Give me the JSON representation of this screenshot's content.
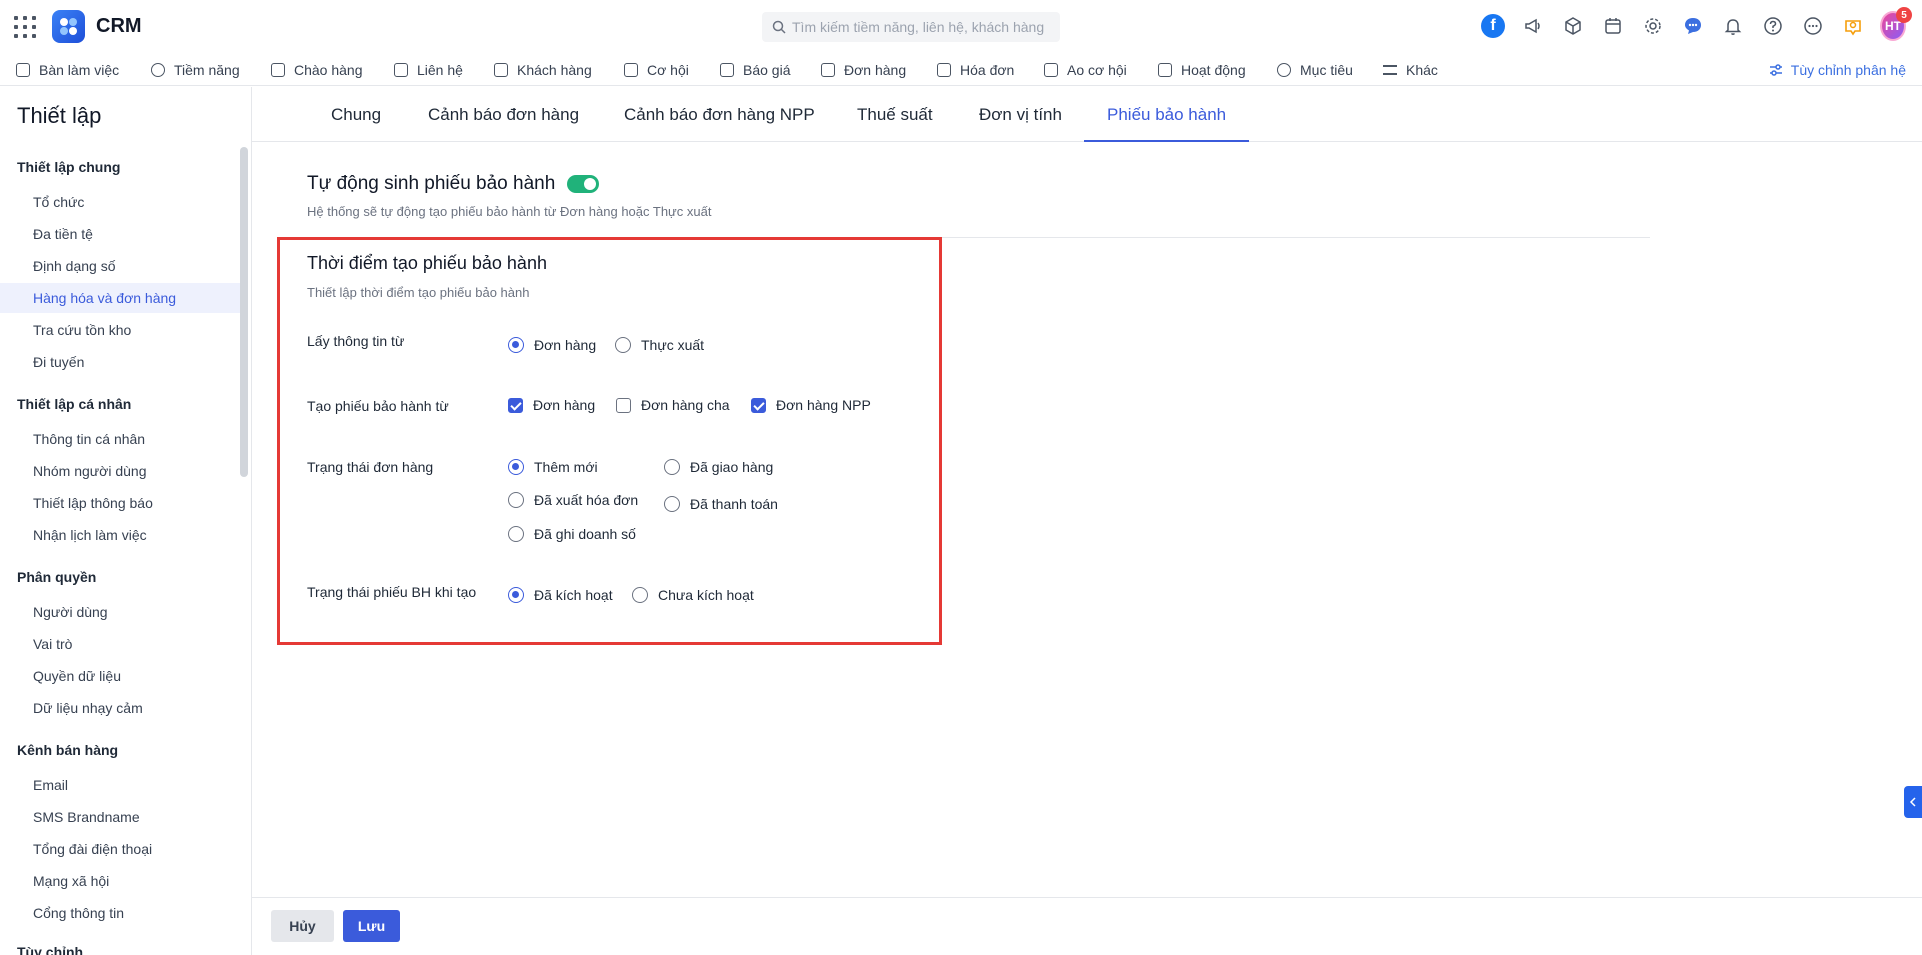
{
  "app": {
    "title": "CRM"
  },
  "search": {
    "placeholder": "Tìm kiếm tiềm năng, liên hệ, khách hàng"
  },
  "header": {
    "notification_count": "5",
    "avatar_initials": "HT"
  },
  "nav": {
    "items": [
      {
        "label": "Bàn làm việc",
        "icon": "home-icon"
      },
      {
        "label": "Tiềm năng",
        "icon": "user-circle-icon"
      },
      {
        "label": "Chào hàng",
        "icon": "magnet-icon"
      },
      {
        "label": "Liên hệ",
        "icon": "contact-icon"
      },
      {
        "label": "Khách hàng",
        "icon": "building-icon"
      },
      {
        "label": "Cơ hội",
        "icon": "briefcase-icon"
      },
      {
        "label": "Báo giá",
        "icon": "quote-icon"
      },
      {
        "label": "Đơn hàng",
        "icon": "cart-icon"
      },
      {
        "label": "Hóa đơn",
        "icon": "invoice-icon"
      },
      {
        "label": "Ao cơ hội",
        "icon": "funnel-icon"
      },
      {
        "label": "Hoạt động",
        "icon": "activity-icon"
      },
      {
        "label": "Mục tiêu",
        "icon": "target-icon"
      },
      {
        "label": "Khác",
        "icon": "menu-icon"
      }
    ],
    "customize_label": "Tùy chỉnh phân hệ"
  },
  "sidebar": {
    "title": "Thiết lập",
    "groups": [
      {
        "label": "Thiết lập chung",
        "items": [
          "Tổ chức",
          "Đa tiền tệ",
          "Định dạng số",
          "Hàng hóa và đơn hàng",
          "Tra cứu tồn kho",
          "Đi tuyến"
        ]
      },
      {
        "label": "Thiết lập cá nhân",
        "items": [
          "Thông tin cá nhân",
          "Nhóm người dùng",
          "Thiết lập thông báo",
          "Nhận lịch làm việc"
        ]
      },
      {
        "label": "Phân quyền",
        "items": [
          "Người dùng",
          "Vai trò",
          "Quyền dữ liệu",
          "Dữ liệu nhạy cảm"
        ]
      },
      {
        "label": "Kênh bán hàng",
        "items": [
          "Email",
          "SMS Brandname",
          "Tổng đài điện thoại",
          "Mạng xã hội",
          "Cổng thông tin"
        ]
      },
      {
        "label": "Tùy chỉnh",
        "items": []
      }
    ],
    "active_item": "Hàng hóa và đơn hàng"
  },
  "tabs": [
    "Chung",
    "Cảnh báo đơn hàng",
    "Cảnh báo đơn hàng NPP",
    "Thuế suất",
    "Đơn vị tính",
    "Phiếu bảo hành"
  ],
  "active_tab": "Phiếu bảo hành",
  "auto_generate": {
    "title": "Tự động sinh phiếu bảo hành",
    "enabled": true,
    "description": "Hệ thống sẽ tự động tạo phiếu bảo hành từ Đơn hàng hoặc Thực xuất"
  },
  "section": {
    "title": "Thời điểm tạo phiếu bảo hành",
    "description": "Thiết lập thời điểm tạo phiếu bảo hành",
    "source": {
      "label": "Lấy thông tin từ",
      "options": [
        {
          "label": "Đơn hàng",
          "selected": true
        },
        {
          "label": "Thực xuất",
          "selected": false
        }
      ]
    },
    "create_from": {
      "label": "Tạo phiếu bảo hành từ",
      "options": [
        {
          "label": "Đơn hàng",
          "checked": true
        },
        {
          "label": "Đơn hàng cha",
          "checked": false
        },
        {
          "label": "Đơn hàng NPP",
          "checked": true
        }
      ]
    },
    "order_status": {
      "label": "Trạng thái đơn hàng",
      "options": [
        {
          "label": "Thêm mới",
          "selected": true
        },
        {
          "label": "Đã giao hàng",
          "selected": false
        },
        {
          "label": "Đã xuất hóa đơn",
          "selected": false
        },
        {
          "label": "Đã thanh toán",
          "selected": false
        },
        {
          "label": "Đã ghi doanh số",
          "selected": false
        }
      ]
    },
    "warranty_status": {
      "label": "Trạng thái phiếu BH khi tạo",
      "options": [
        {
          "label": "Đã kích hoạt",
          "selected": true
        },
        {
          "label": "Chưa kích hoạt",
          "selected": false
        }
      ]
    }
  },
  "footer": {
    "cancel_label": "Hủy",
    "save_label": "Lưu"
  },
  "colors": {
    "accent": "#3b5bdb",
    "toggle_on": "#20b27a",
    "highlight_border": "#e53935"
  }
}
